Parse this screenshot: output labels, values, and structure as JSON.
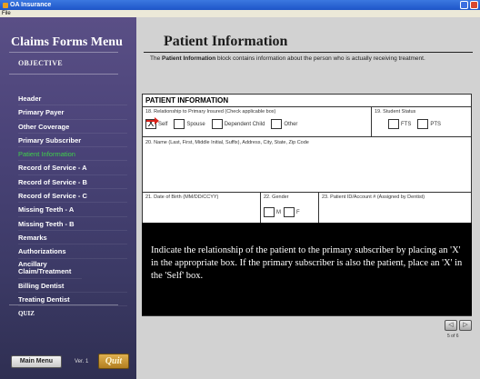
{
  "window": {
    "title": "OA Insurance",
    "menu": "File"
  },
  "sidebar": {
    "title": "Claims Forms Menu",
    "objective": "OBJECTIVE",
    "items": [
      {
        "label": "Header"
      },
      {
        "label": "Primary Payer"
      },
      {
        "label": "Other Coverage"
      },
      {
        "label": "Primary Subscriber"
      },
      {
        "label": "Patient Information"
      },
      {
        "label": "Record of Service - A"
      },
      {
        "label": "Record of Service - B"
      },
      {
        "label": "Record of Service - C"
      },
      {
        "label": "Missing Teeth - A"
      },
      {
        "label": "Missing Teeth - B"
      },
      {
        "label": "Remarks"
      },
      {
        "label": "Authorizations"
      },
      {
        "label": "Ancillary Claim/Treatment"
      },
      {
        "label": "Billing Dentist"
      },
      {
        "label": "Treating Dentist"
      }
    ],
    "quiz": "QUIZ",
    "main_menu": "Main Menu",
    "version": "Ver. 1",
    "quit": "Quit"
  },
  "main": {
    "title": "Patient Information",
    "desc_pre": "The ",
    "desc_bold": "Patient Information",
    "desc_post": " block contains information about the person who is actually receiving treatment.",
    "form": {
      "header": "PATIENT INFORMATION",
      "field18_label": "18. Relationship to Primary Insured (Check applicable box)",
      "rel_options": [
        "Self",
        "Spouse",
        "Dependent Child",
        "Other"
      ],
      "rel_checked_mark": "X",
      "field19_label": "19. Student Status",
      "student_options": [
        "FTS",
        "PTS"
      ],
      "field20_label": "20. Name (Last, First, Middle Initial, Suffix), Address, City, State, Zip Code",
      "field21_label": "21. Date of Birth (MM/DD/CCYY)",
      "field22_label": "22. Gender",
      "gender_options": [
        "M",
        "F"
      ],
      "field23_label": "23. Patient ID/Account # (Assigned by Dentist)"
    },
    "instruction": "Indicate the relationship of the patient to the primary subscriber by placing an 'X' in the appropriate box.  If the primary subscriber is also the patient, place an 'X' in the 'Self' box.",
    "prev_label": "◁",
    "next_label": "▷",
    "page_indicator": "5 of 6"
  }
}
